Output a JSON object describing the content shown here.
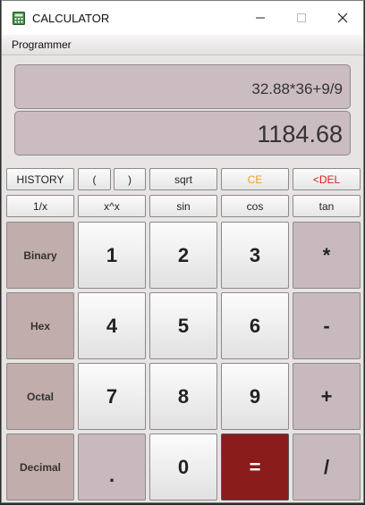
{
  "window": {
    "title": "CALCULATOR",
    "minimize_icon": "minimize-icon",
    "maximize_icon": "maximize-icon",
    "close_icon": "close-icon"
  },
  "menu": {
    "items": [
      "Programmer"
    ]
  },
  "display": {
    "expression": "32.88*36+9/9",
    "result": "1184.68"
  },
  "function_row_1": {
    "history": "HISTORY",
    "open_paren": "(",
    "close_paren": ")",
    "sqrt": "sqrt",
    "clear_entry": "CE",
    "delete": "<DEL"
  },
  "function_row_2": {
    "reciprocal": "1/x",
    "power": "x^x",
    "sin": "sin",
    "cos": "cos",
    "tan": "tan"
  },
  "modes": [
    "Binary",
    "Hex",
    "Octal",
    "Decimal"
  ],
  "keypad": {
    "digits": [
      "1",
      "2",
      "3",
      "4",
      "5",
      "6",
      "7",
      "8",
      "9",
      "0"
    ],
    "multiply": "*",
    "subtract": "-",
    "add": "+",
    "divide": "/",
    "decimal": ".",
    "equals": "="
  },
  "colors": {
    "ce_text": "#e8a020",
    "del_text": "#d42020",
    "equals_bg": "#8b1c1c"
  }
}
